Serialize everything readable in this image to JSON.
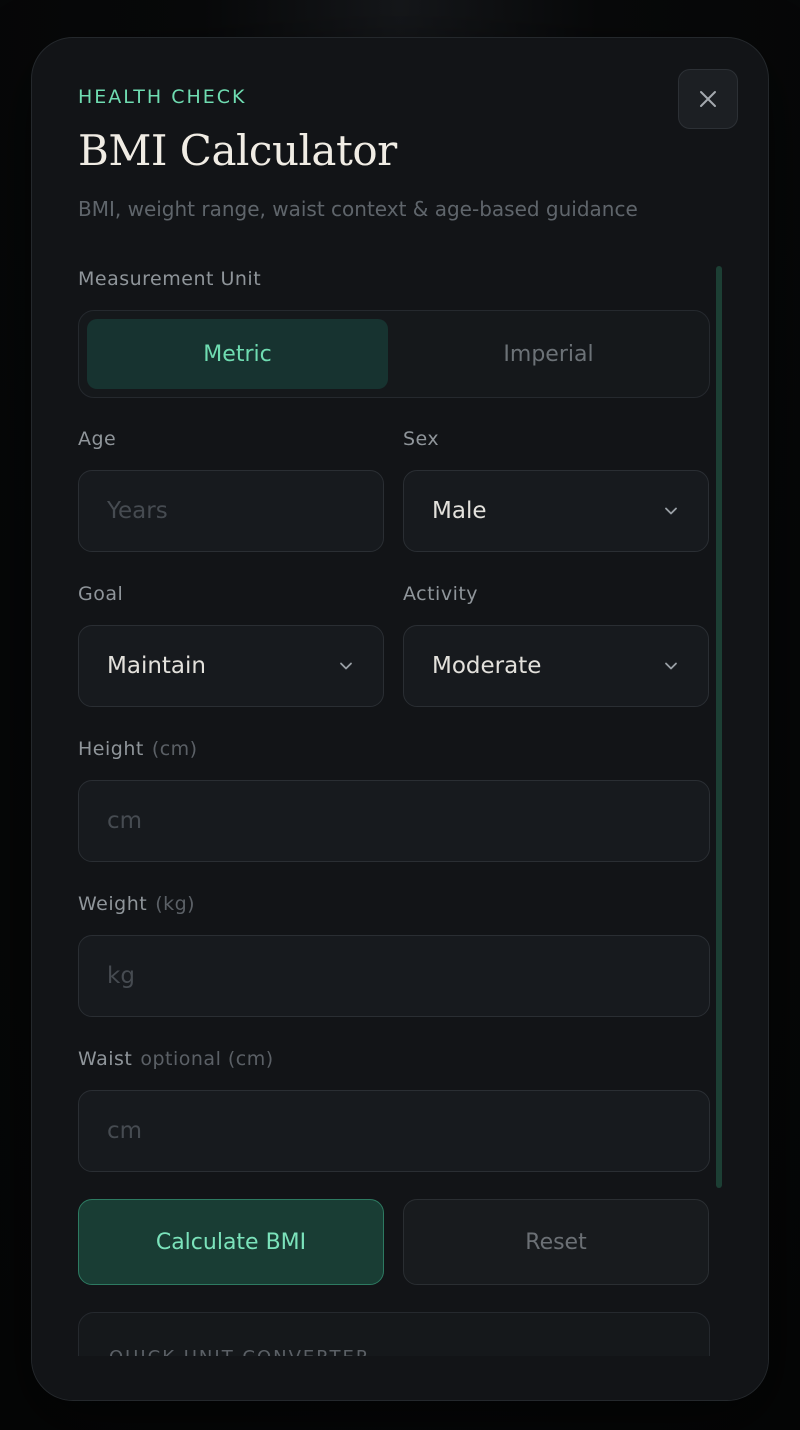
{
  "header": {
    "eyebrow": "HEALTH CHECK",
    "title": "BMI Calculator",
    "subtitle": "BMI, weight range, waist context & age-based guidance"
  },
  "unit": {
    "label": "Measurement Unit",
    "options": [
      "Metric",
      "Imperial"
    ],
    "selected": "Metric"
  },
  "age": {
    "label": "Age",
    "placeholder": "Years"
  },
  "sex": {
    "label": "Sex",
    "value": "Male"
  },
  "goal": {
    "label": "Goal",
    "value": "Maintain"
  },
  "activity": {
    "label": "Activity",
    "value": "Moderate"
  },
  "height": {
    "label": "Height",
    "unit": "(cm)",
    "placeholder": "cm"
  },
  "weight": {
    "label": "Weight",
    "unit": "(kg)",
    "placeholder": "kg"
  },
  "waist": {
    "label": "Waist",
    "unit": "optional (cm)",
    "placeholder": "cm"
  },
  "actions": {
    "calculate": "Calculate BMI",
    "reset": "Reset"
  },
  "converter": {
    "title": "QUICK UNIT CONVERTER"
  },
  "icons": {
    "close": "close-icon",
    "chevron": "chevron-down-icon"
  },
  "colors": {
    "accent": "#6fdcb1",
    "background": "#121417"
  }
}
